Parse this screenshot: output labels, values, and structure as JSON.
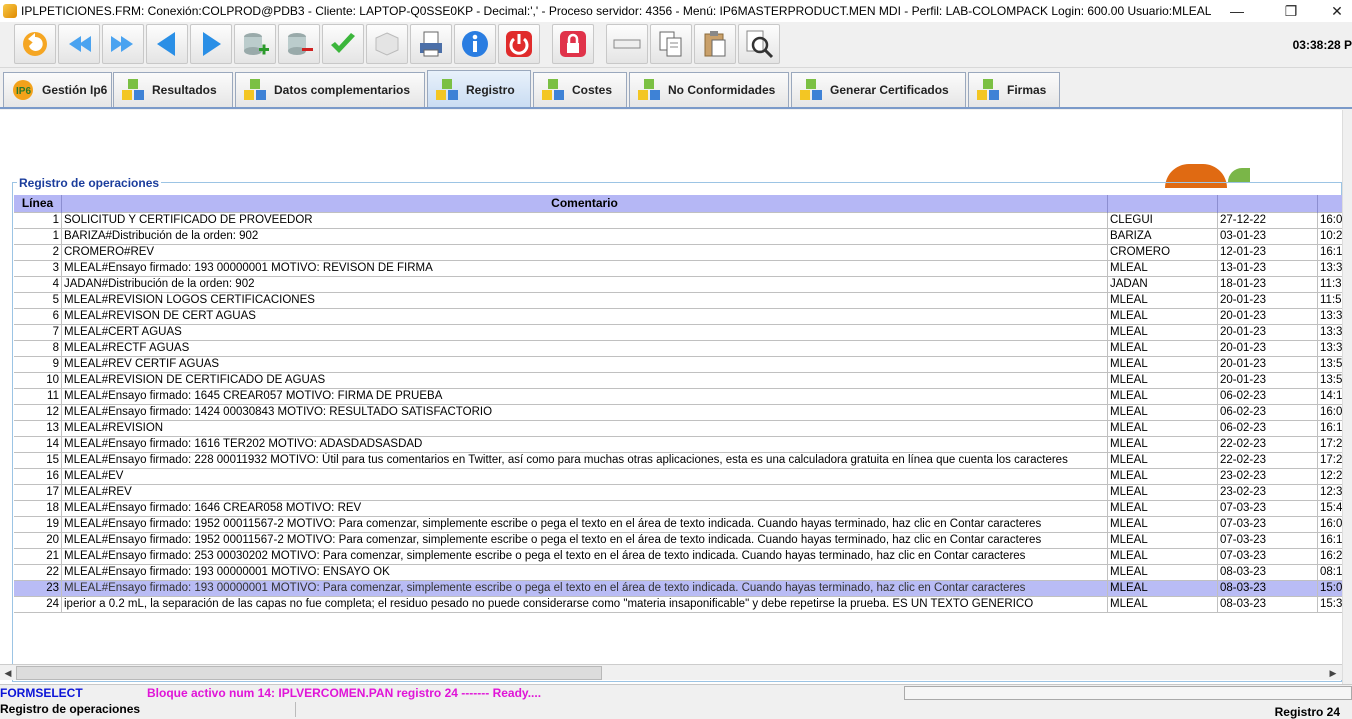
{
  "window": {
    "title": "IPLPETICIONES.FRM:     Conexión:COLPROD@PDB3 - Cliente: LAPTOP-Q0SSE0KP - Decimal:',' - Proceso servidor: 4356 - Menú: IP6MASTERPRODUCT.MEN MDI - Perfil: LAB-COLOMPACK Login: 600.00      Usuario:MLEAL",
    "minimize": "—",
    "restore": "❐",
    "close": "✕"
  },
  "toolbar": {
    "clock": "03:38:28 P",
    "buttons": [
      "undo-icon",
      "first-icon",
      "last-icon",
      "prev-icon",
      "next-icon",
      "add-record-icon",
      "delete-record-icon",
      "accept-icon",
      "cube-icon",
      "print-icon",
      "info-icon",
      "power-icon",
      "lock-icon",
      "field-icon",
      "copy-icon",
      "paste-icon",
      "search-icon"
    ]
  },
  "tabs": [
    {
      "label": "Gestión Ip6",
      "active": false
    },
    {
      "label": "Resultados",
      "active": false
    },
    {
      "label": "Datos complementarios",
      "active": false
    },
    {
      "label": "Registro",
      "active": true
    },
    {
      "label": "Costes",
      "active": false
    },
    {
      "label": "No Conformidades",
      "active": false
    },
    {
      "label": "Generar Certificados",
      "active": false
    },
    {
      "label": "Firmas",
      "active": false
    }
  ],
  "panel": {
    "legend": "Registro de operaciones"
  },
  "grid": {
    "headers": [
      "Línea",
      "Comentario",
      "",
      "",
      ""
    ],
    "rows": [
      [
        "1",
        "SOLICITUD Y CERTIFICADO DE PROVEEDOR",
        "CLEGUI",
        "27-12-22",
        "16:0"
      ],
      [
        "1",
        "BARIZA#Distribución de la orden: 902",
        "BARIZA",
        "03-01-23",
        "10:2"
      ],
      [
        "2",
        "CROMERO#REV",
        "CROMERO",
        "12-01-23",
        "16:1"
      ],
      [
        "3",
        "MLEAL#Ensayo firmado: 193 00000001 MOTIVO: REVISON DE FIRMA",
        "MLEAL",
        "13-01-23",
        "13:3"
      ],
      [
        "4",
        "JADAN#Distribución de la orden: 902",
        "JADAN",
        "18-01-23",
        "11:3"
      ],
      [
        "5",
        "MLEAL#REVISION LOGOS CERTIFICACIONES",
        "MLEAL",
        "20-01-23",
        "11:5"
      ],
      [
        "6",
        "MLEAL#REVISON DE CERT AGUAS",
        "MLEAL",
        "20-01-23",
        "13:3"
      ],
      [
        "7",
        "MLEAL#CERT AGUAS",
        "MLEAL",
        "20-01-23",
        "13:3"
      ],
      [
        "8",
        "MLEAL#RECTF AGUAS",
        "MLEAL",
        "20-01-23",
        "13:3"
      ],
      [
        "9",
        "MLEAL#REV CERTIF AGUAS",
        "MLEAL",
        "20-01-23",
        "13:5"
      ],
      [
        "10",
        "MLEAL#REVISION DE CERTIFICADO DE AGUAS",
        "MLEAL",
        "20-01-23",
        "13:5"
      ],
      [
        "11",
        "MLEAL#Ensayo firmado: 1645 CREAR057 MOTIVO: FIRMA DE PRUEBA",
        "MLEAL",
        "06-02-23",
        "14:1"
      ],
      [
        "12",
        "MLEAL#Ensayo firmado: 1424 00030843 MOTIVO: RESULTADO SATISFACTORIO",
        "MLEAL",
        "06-02-23",
        "16:0"
      ],
      [
        "13",
        "MLEAL#REVISION",
        "MLEAL",
        "06-02-23",
        "16:1"
      ],
      [
        "14",
        "MLEAL#Ensayo firmado: 1616 TER202 MOTIVO: ADASDADSASDAD",
        "MLEAL",
        "22-02-23",
        "17:2"
      ],
      [
        "15",
        "MLEAL#Ensayo firmado: 228 00011932 MOTIVO: Útil para tus comentarios en Twitter, así como para muchas otras aplicaciones, esta es una calculadora gratuita en línea que cuenta los caracteres",
        "MLEAL",
        "22-02-23",
        "17:2"
      ],
      [
        "16",
        "MLEAL#EV",
        "MLEAL",
        "23-02-23",
        "12:2"
      ],
      [
        "17",
        "MLEAL#REV",
        "MLEAL",
        "23-02-23",
        "12:3"
      ],
      [
        "18",
        "MLEAL#Ensayo firmado: 1646 CREAR058 MOTIVO: REV",
        "MLEAL",
        "07-03-23",
        "15:4"
      ],
      [
        "19",
        "MLEAL#Ensayo firmado: 1952 00011567-2 MOTIVO: Para comenzar, simplemente escribe o pega el texto en el área de texto indicada. Cuando hayas terminado, haz clic en Contar caracteres",
        "MLEAL",
        "07-03-23",
        "16:0"
      ],
      [
        "20",
        "MLEAL#Ensayo firmado: 1952 00011567-2 MOTIVO: Para comenzar, simplemente escribe o pega el texto en el área de texto indicada. Cuando hayas terminado, haz clic en Contar caracteres",
        "MLEAL",
        "07-03-23",
        "16:1"
      ],
      [
        "21",
        "MLEAL#Ensayo firmado: 253 00030202 MOTIVO: Para comenzar, simplemente escribe o pega el texto en el área de texto indicada. Cuando hayas terminado, haz clic en Contar caracteres",
        "MLEAL",
        "07-03-23",
        "16:2"
      ],
      [
        "22",
        "MLEAL#Ensayo firmado: 193 00000001 MOTIVO: ENSAYO OK",
        "MLEAL",
        "08-03-23",
        "08:1"
      ],
      [
        "23",
        "MLEAL#Ensayo firmado: 193 00000001 MOTIVO: Para comenzar, simplemente escribe o pega el texto en el área de texto indicada. Cuando hayas terminado, haz clic en Contar caracteres",
        "MLEAL",
        "08-03-23",
        "15:0"
      ],
      [
        "24",
        "iperior a 0.2 mL, la separación de las capas no fue completa; el residuo pesado no puede considerarse como \"materia insaponificable\" y debe repetirse la prueba. ES UN TEXTO GENERICO",
        "MLEAL",
        "08-03-23",
        "15:3"
      ]
    ],
    "selected_row": 24
  },
  "status": {
    "form": "FORMSELECT",
    "message": "Bloque activo num 14: IPLVERCOMEN.PAN  registro 24 ------- Ready...."
  },
  "footer": {
    "left": "Registro de operaciones",
    "right": "Registro 24"
  }
}
